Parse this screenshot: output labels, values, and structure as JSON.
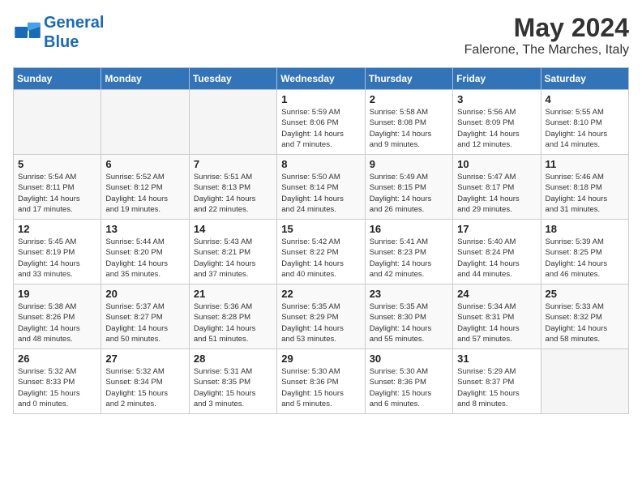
{
  "header": {
    "logo_line1": "General",
    "logo_line2": "Blue",
    "month": "May 2024",
    "location": "Falerone, The Marches, Italy"
  },
  "days_of_week": [
    "Sunday",
    "Monday",
    "Tuesday",
    "Wednesday",
    "Thursday",
    "Friday",
    "Saturday"
  ],
  "weeks": [
    [
      {
        "day": "",
        "info": ""
      },
      {
        "day": "",
        "info": ""
      },
      {
        "day": "",
        "info": ""
      },
      {
        "day": "1",
        "info": "Sunrise: 5:59 AM\nSunset: 8:06 PM\nDaylight: 14 hours\nand 7 minutes."
      },
      {
        "day": "2",
        "info": "Sunrise: 5:58 AM\nSunset: 8:08 PM\nDaylight: 14 hours\nand 9 minutes."
      },
      {
        "day": "3",
        "info": "Sunrise: 5:56 AM\nSunset: 8:09 PM\nDaylight: 14 hours\nand 12 minutes."
      },
      {
        "day": "4",
        "info": "Sunrise: 5:55 AM\nSunset: 8:10 PM\nDaylight: 14 hours\nand 14 minutes."
      }
    ],
    [
      {
        "day": "5",
        "info": "Sunrise: 5:54 AM\nSunset: 8:11 PM\nDaylight: 14 hours\nand 17 minutes."
      },
      {
        "day": "6",
        "info": "Sunrise: 5:52 AM\nSunset: 8:12 PM\nDaylight: 14 hours\nand 19 minutes."
      },
      {
        "day": "7",
        "info": "Sunrise: 5:51 AM\nSunset: 8:13 PM\nDaylight: 14 hours\nand 22 minutes."
      },
      {
        "day": "8",
        "info": "Sunrise: 5:50 AM\nSunset: 8:14 PM\nDaylight: 14 hours\nand 24 minutes."
      },
      {
        "day": "9",
        "info": "Sunrise: 5:49 AM\nSunset: 8:15 PM\nDaylight: 14 hours\nand 26 minutes."
      },
      {
        "day": "10",
        "info": "Sunrise: 5:47 AM\nSunset: 8:17 PM\nDaylight: 14 hours\nand 29 minutes."
      },
      {
        "day": "11",
        "info": "Sunrise: 5:46 AM\nSunset: 8:18 PM\nDaylight: 14 hours\nand 31 minutes."
      }
    ],
    [
      {
        "day": "12",
        "info": "Sunrise: 5:45 AM\nSunset: 8:19 PM\nDaylight: 14 hours\nand 33 minutes."
      },
      {
        "day": "13",
        "info": "Sunrise: 5:44 AM\nSunset: 8:20 PM\nDaylight: 14 hours\nand 35 minutes."
      },
      {
        "day": "14",
        "info": "Sunrise: 5:43 AM\nSunset: 8:21 PM\nDaylight: 14 hours\nand 37 minutes."
      },
      {
        "day": "15",
        "info": "Sunrise: 5:42 AM\nSunset: 8:22 PM\nDaylight: 14 hours\nand 40 minutes."
      },
      {
        "day": "16",
        "info": "Sunrise: 5:41 AM\nSunset: 8:23 PM\nDaylight: 14 hours\nand 42 minutes."
      },
      {
        "day": "17",
        "info": "Sunrise: 5:40 AM\nSunset: 8:24 PM\nDaylight: 14 hours\nand 44 minutes."
      },
      {
        "day": "18",
        "info": "Sunrise: 5:39 AM\nSunset: 8:25 PM\nDaylight: 14 hours\nand 46 minutes."
      }
    ],
    [
      {
        "day": "19",
        "info": "Sunrise: 5:38 AM\nSunset: 8:26 PM\nDaylight: 14 hours\nand 48 minutes."
      },
      {
        "day": "20",
        "info": "Sunrise: 5:37 AM\nSunset: 8:27 PM\nDaylight: 14 hours\nand 50 minutes."
      },
      {
        "day": "21",
        "info": "Sunrise: 5:36 AM\nSunset: 8:28 PM\nDaylight: 14 hours\nand 51 minutes."
      },
      {
        "day": "22",
        "info": "Sunrise: 5:35 AM\nSunset: 8:29 PM\nDaylight: 14 hours\nand 53 minutes."
      },
      {
        "day": "23",
        "info": "Sunrise: 5:35 AM\nSunset: 8:30 PM\nDaylight: 14 hours\nand 55 minutes."
      },
      {
        "day": "24",
        "info": "Sunrise: 5:34 AM\nSunset: 8:31 PM\nDaylight: 14 hours\nand 57 minutes."
      },
      {
        "day": "25",
        "info": "Sunrise: 5:33 AM\nSunset: 8:32 PM\nDaylight: 14 hours\nand 58 minutes."
      }
    ],
    [
      {
        "day": "26",
        "info": "Sunrise: 5:32 AM\nSunset: 8:33 PM\nDaylight: 15 hours\nand 0 minutes."
      },
      {
        "day": "27",
        "info": "Sunrise: 5:32 AM\nSunset: 8:34 PM\nDaylight: 15 hours\nand 2 minutes."
      },
      {
        "day": "28",
        "info": "Sunrise: 5:31 AM\nSunset: 8:35 PM\nDaylight: 15 hours\nand 3 minutes."
      },
      {
        "day": "29",
        "info": "Sunrise: 5:30 AM\nSunset: 8:36 PM\nDaylight: 15 hours\nand 5 minutes."
      },
      {
        "day": "30",
        "info": "Sunrise: 5:30 AM\nSunset: 8:36 PM\nDaylight: 15 hours\nand 6 minutes."
      },
      {
        "day": "31",
        "info": "Sunrise: 5:29 AM\nSunset: 8:37 PM\nDaylight: 15 hours\nand 8 minutes."
      },
      {
        "day": "",
        "info": ""
      }
    ]
  ]
}
